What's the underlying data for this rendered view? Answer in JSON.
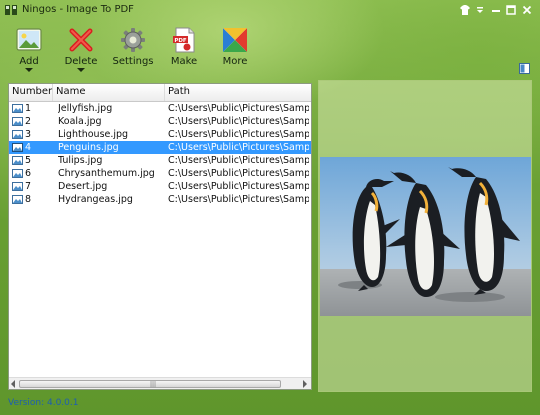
{
  "window": {
    "title": "Ningos - Image To PDF"
  },
  "toolbar": {
    "add_label": "Add",
    "delete_label": "Delete",
    "settings_label": "Settings",
    "make_label": "Make",
    "more_label": "More"
  },
  "list": {
    "columns": [
      "Number",
      "Name",
      "Path"
    ],
    "rows": [
      {
        "number": "1",
        "name": "Jellyfish.jpg",
        "path": "C:\\Users\\Public\\Pictures\\Sample Pict"
      },
      {
        "number": "2",
        "name": "Koala.jpg",
        "path": "C:\\Users\\Public\\Pictures\\Sample Pict"
      },
      {
        "number": "3",
        "name": "Lighthouse.jpg",
        "path": "C:\\Users\\Public\\Pictures\\Sample Pict"
      },
      {
        "number": "4",
        "name": "Penguins.jpg",
        "path": "C:\\Users\\Public\\Pictures\\Sample Pict"
      },
      {
        "number": "5",
        "name": "Tulips.jpg",
        "path": "C:\\Users\\Public\\Pictures\\Sample Pict"
      },
      {
        "number": "6",
        "name": "Chrysanthemum.jpg",
        "path": "C:\\Users\\Public\\Pictures\\Sample Pict"
      },
      {
        "number": "7",
        "name": "Desert.jpg",
        "path": "C:\\Users\\Public\\Pictures\\Sample Pict"
      },
      {
        "number": "8",
        "name": "Hydrangeas.jpg",
        "path": "C:\\Users\\Public\\Pictures\\Sample Pict"
      }
    ],
    "selected_row": "4"
  },
  "status": {
    "version": "Version: 4.0.0.1"
  },
  "icons": {
    "app": "app-logo-icon",
    "add": "image-add-icon",
    "delete": "red-x-icon",
    "settings": "gear-icon",
    "make": "pdf-file-icon",
    "more": "colorful-x-icon",
    "view_toggle": "layout-icon",
    "row": "image-file-icon"
  },
  "colors": {
    "selection": "#3399ff",
    "version_text": "#1f5fb0",
    "background": "#6da434"
  }
}
